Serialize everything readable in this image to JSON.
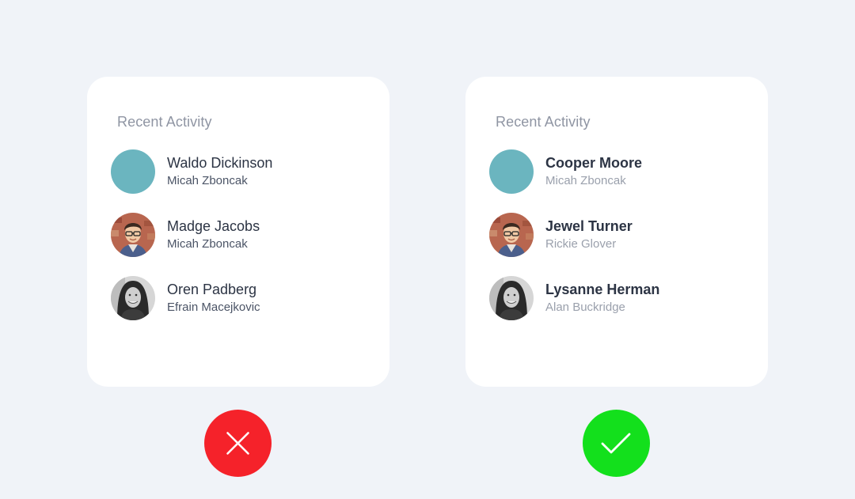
{
  "left_card": {
    "title": "Recent Activity",
    "items": [
      {
        "name": "Waldo Dickinson",
        "sub": "Micah Zboncak",
        "avatar": "teal-circle"
      },
      {
        "name": "Madge Jacobs",
        "sub": "Micah Zboncak",
        "avatar": "photo-man-glasses"
      },
      {
        "name": "Oren Padberg",
        "sub": "Efrain Macejkovic",
        "avatar": "photo-woman-bw"
      }
    ]
  },
  "right_card": {
    "title": "Recent Activity",
    "items": [
      {
        "name": "Cooper Moore",
        "sub": "Micah Zboncak",
        "avatar": "teal-circle"
      },
      {
        "name": "Jewel Turner",
        "sub": "Rickie Glover",
        "avatar": "photo-man-glasses"
      },
      {
        "name": "Lysanne Herman",
        "sub": "Alan Buckridge",
        "avatar": "photo-woman-bw"
      }
    ]
  },
  "badges": {
    "bad": {
      "icon": "close-icon",
      "color": "#f5222a"
    },
    "good": {
      "icon": "check-icon",
      "color": "#13e01c"
    }
  },
  "colors": {
    "background": "#f0f3f8",
    "card": "#ffffff",
    "teal": "#6bb5bf"
  }
}
